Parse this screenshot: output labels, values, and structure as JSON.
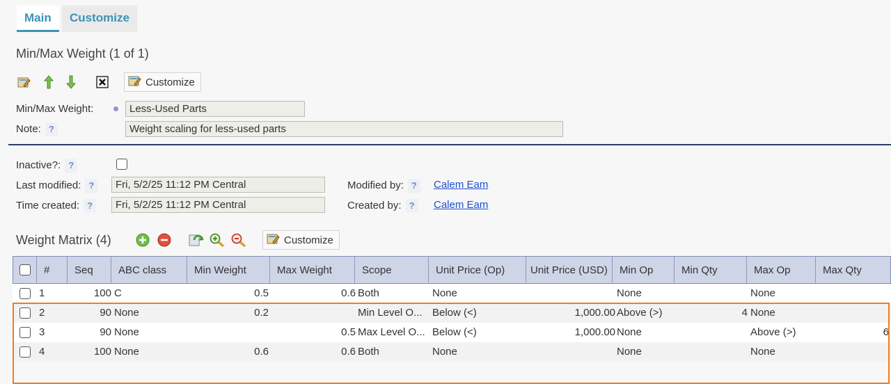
{
  "tabs": {
    "main": "Main",
    "customize": "Customize"
  },
  "form": {
    "title": "Min/Max Weight (1 of 1)",
    "customize_label": "Customize",
    "weight_label": "Min/Max Weight:",
    "weight_value": "Less-Used Parts",
    "note_label": "Note:",
    "note_value": "Weight scaling for less-used parts",
    "help_glyph": "?",
    "inactive_label": "Inactive?:",
    "last_modified_label": "Last modified:",
    "last_modified_value": "Fri, 5/2/25 11:12 PM Central",
    "time_created_label": "Time created:",
    "time_created_value": "Fri, 5/2/25 11:12 PM Central",
    "modified_by_label": "Modified by:",
    "modified_by_value": "Calem Eam",
    "created_by_label": "Created by:",
    "created_by_value": "Calem Eam"
  },
  "matrix": {
    "title": "Weight Matrix (4)",
    "customize_label": "Customize",
    "columns": [
      "#",
      "Seq",
      "ABC class",
      "Min Weight",
      "Max Weight",
      "Scope",
      "Unit Price (Op)",
      "Unit Price (USD)",
      "Min Op",
      "Min Qty",
      "Max Op",
      "Max Qty"
    ],
    "rows": [
      {
        "num": "1",
        "seq": "100",
        "abc": "C",
        "min_w": "0.5",
        "max_w": "0.6",
        "scope": "Both",
        "up_op": "None",
        "up_usd": "",
        "min_op": "None",
        "min_qty": "",
        "max_op": "None",
        "max_qty": ""
      },
      {
        "num": "2",
        "seq": "90",
        "abc": "None",
        "min_w": "0.2",
        "max_w": "",
        "scope": "Min Level O...",
        "up_op": "Below (<)",
        "up_usd": "1,000.00",
        "min_op": "Above (>)",
        "min_qty": "4",
        "max_op": "None",
        "max_qty": ""
      },
      {
        "num": "3",
        "seq": "90",
        "abc": "None",
        "min_w": "",
        "max_w": "0.5",
        "scope": "Max Level O...",
        "up_op": "Below (<)",
        "up_usd": "1,000.00",
        "min_op": "None",
        "min_qty": "",
        "max_op": "Above (>)",
        "max_qty": "6"
      },
      {
        "num": "4",
        "seq": "100",
        "abc": "None",
        "min_w": "0.6",
        "max_w": "0.6",
        "scope": "Both",
        "up_op": "None",
        "up_usd": "",
        "min_op": "None",
        "min_qty": "",
        "max_op": "None",
        "max_qty": ""
      }
    ]
  },
  "colors": {
    "accent": "#3b93b5",
    "header_bg": "#cfd5e7",
    "highlight": "#f07d22",
    "link": "#1a4fd6"
  }
}
